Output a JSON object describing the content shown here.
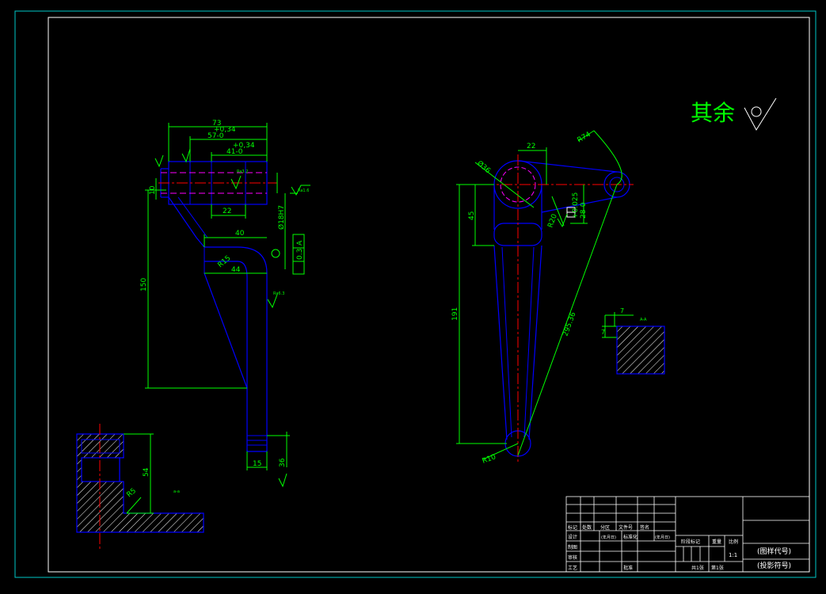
{
  "note": {
    "remainder": "其余"
  },
  "dims_left": {
    "d73": "73",
    "d034a": "+0,34",
    "d570": "57-0",
    "d034b": "+0,34",
    "d410": "41-0",
    "d22": "22",
    "d40": "40",
    "r15": "R15",
    "d44": "44",
    "d150": "150",
    "d10": "10",
    "d18h7": "Ø18H7",
    "d15": "15",
    "d36": "36",
    "tol": "0.3",
    "datum": "A",
    "ra16": "Ra1.6",
    "ra32": "Ra3.2",
    "ra63": "Ra6.3"
  },
  "dims_right": {
    "d22": "22",
    "d36": "Ø36",
    "r74": "R74",
    "d45": "45",
    "d191": "191",
    "r20": "R20",
    "d0025": "+0.025",
    "d280": "28-0",
    "d29536": "295.36",
    "r10": "R10",
    "sec7a": "7",
    "sec7b": "7",
    "secAA": "A-A"
  },
  "dims_bottom": {
    "d54": "54",
    "r5": "R5",
    "mark": "a-a"
  },
  "title_block": {
    "row1": [
      "标记",
      "处数",
      "分区",
      "文件号",
      "签名"
    ],
    "design": "设计",
    "design_sig": "(年月日)",
    "std": "标准化",
    "std_sig": "(年月日)",
    "draw": "制图",
    "check": "审核",
    "process": "工艺",
    "approve": "批准",
    "stage": "阶段标记",
    "weight": "重量",
    "scale_label": "比例",
    "scale": "1:1",
    "sheets": "共1张",
    "sheet": "第1张",
    "code": "(图样代号)",
    "proj": "(投影符号)"
  }
}
